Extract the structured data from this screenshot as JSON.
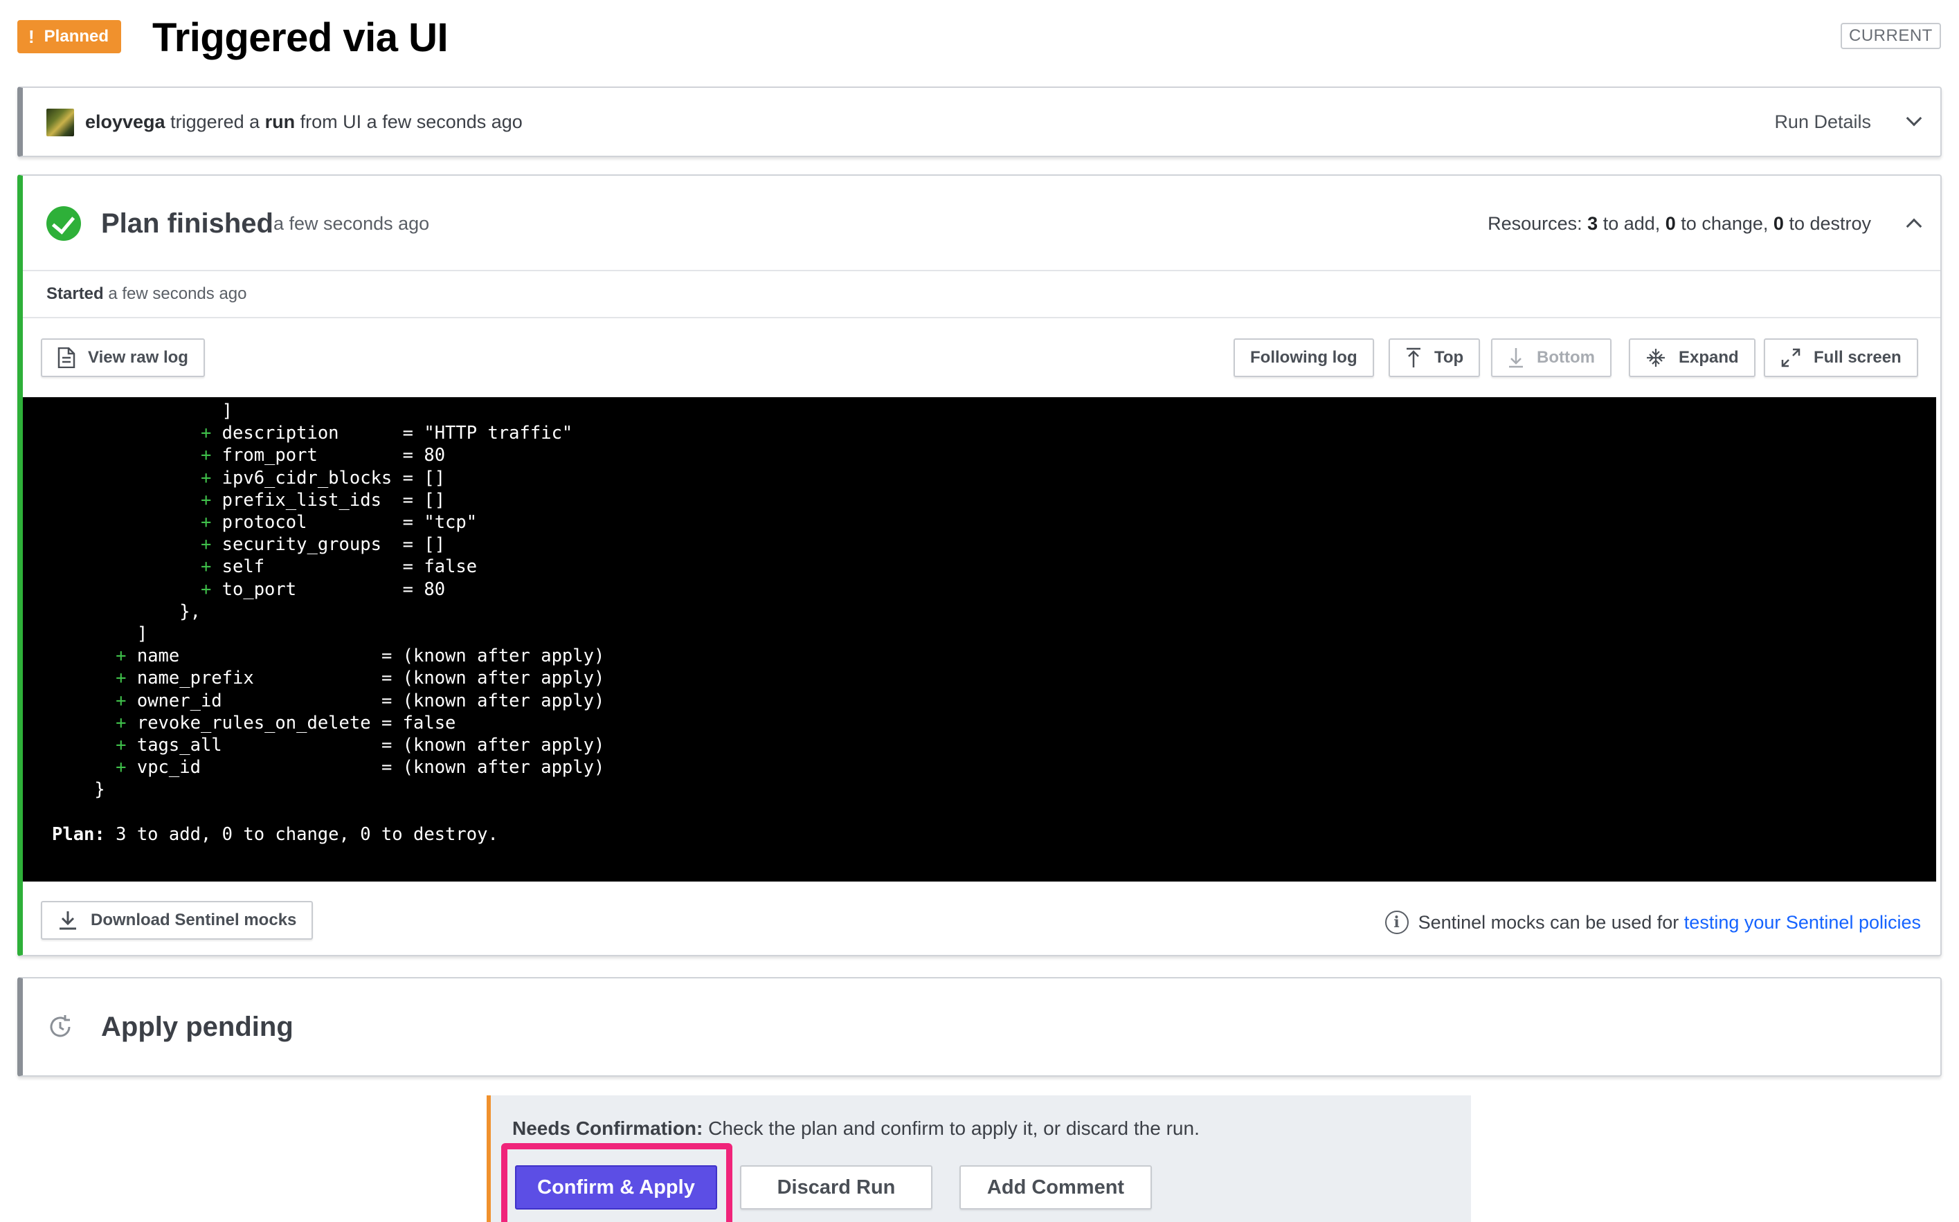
{
  "header": {
    "status_badge": "Planned",
    "status_icon": "!",
    "title": "Triggered via UI",
    "current_tag": "CURRENT"
  },
  "trigger": {
    "user": "eloyvega",
    "text1": " triggered a ",
    "run_word": "run",
    "text2": " from UI a few seconds ago",
    "run_details_label": "Run Details"
  },
  "plan": {
    "title": "Plan finished",
    "time": "a few seconds ago",
    "resources_prefix": "Resources: ",
    "add_count": "3",
    "add_text": " to add, ",
    "change_count": "0",
    "change_text": " to change, ",
    "destroy_count": "0",
    "destroy_text": " to destroy",
    "started_label": "Started",
    "started_time": " a few seconds ago",
    "toolbar": {
      "view_raw_log": "View raw log",
      "following_log": "Following log",
      "top": "Top",
      "bottom": "Bottom",
      "expand": "Expand",
      "full_screen": "Full screen"
    },
    "log_lines": [
      {
        "indent": "                ",
        "plus": "",
        "text": "]"
      },
      {
        "indent": "              ",
        "plus": "+",
        "text": " description      = \"HTTP traffic\""
      },
      {
        "indent": "              ",
        "plus": "+",
        "text": " from_port        = 80"
      },
      {
        "indent": "              ",
        "plus": "+",
        "text": " ipv6_cidr_blocks = []"
      },
      {
        "indent": "              ",
        "plus": "+",
        "text": " prefix_list_ids  = []"
      },
      {
        "indent": "              ",
        "plus": "+",
        "text": " protocol         = \"tcp\""
      },
      {
        "indent": "              ",
        "plus": "+",
        "text": " security_groups  = []"
      },
      {
        "indent": "              ",
        "plus": "+",
        "text": " self             = false"
      },
      {
        "indent": "              ",
        "plus": "+",
        "text": " to_port          = 80"
      },
      {
        "indent": "            ",
        "plus": "",
        "text": "},"
      },
      {
        "indent": "        ",
        "plus": "",
        "text": "]"
      },
      {
        "indent": "      ",
        "plus": "+",
        "text": " name                   = (known after apply)"
      },
      {
        "indent": "      ",
        "plus": "+",
        "text": " name_prefix            = (known after apply)"
      },
      {
        "indent": "      ",
        "plus": "+",
        "text": " owner_id               = (known after apply)"
      },
      {
        "indent": "      ",
        "plus": "+",
        "text": " revoke_rules_on_delete = false"
      },
      {
        "indent": "      ",
        "plus": "+",
        "text": " tags_all               = (known after apply)"
      },
      {
        "indent": "      ",
        "plus": "+",
        "text": " vpc_id                 = (known after apply)"
      },
      {
        "indent": "    ",
        "plus": "",
        "text": "}"
      },
      {
        "indent": "",
        "plus": "",
        "text": ""
      }
    ],
    "plan_summary_label": "Plan:",
    "plan_summary_text": " 3 to add, 0 to change, 0 to destroy.",
    "download_mocks": "Download Sentinel mocks",
    "mocks_info_text": "Sentinel mocks can be used for ",
    "mocks_info_link": "testing your Sentinel policies"
  },
  "apply": {
    "title": "Apply pending"
  },
  "confirmation": {
    "label": "Needs Confirmation:",
    "message": " Check the plan and confirm to apply it, or discard the run.",
    "confirm_button": "Confirm & Apply",
    "discard_button": "Discard Run",
    "comment_button": "Add Comment"
  },
  "colors": {
    "planned": "#f0912d",
    "success": "#2eb039",
    "primary": "#5c4ee5",
    "highlight": "#f0247a",
    "link": "#1563ff"
  }
}
